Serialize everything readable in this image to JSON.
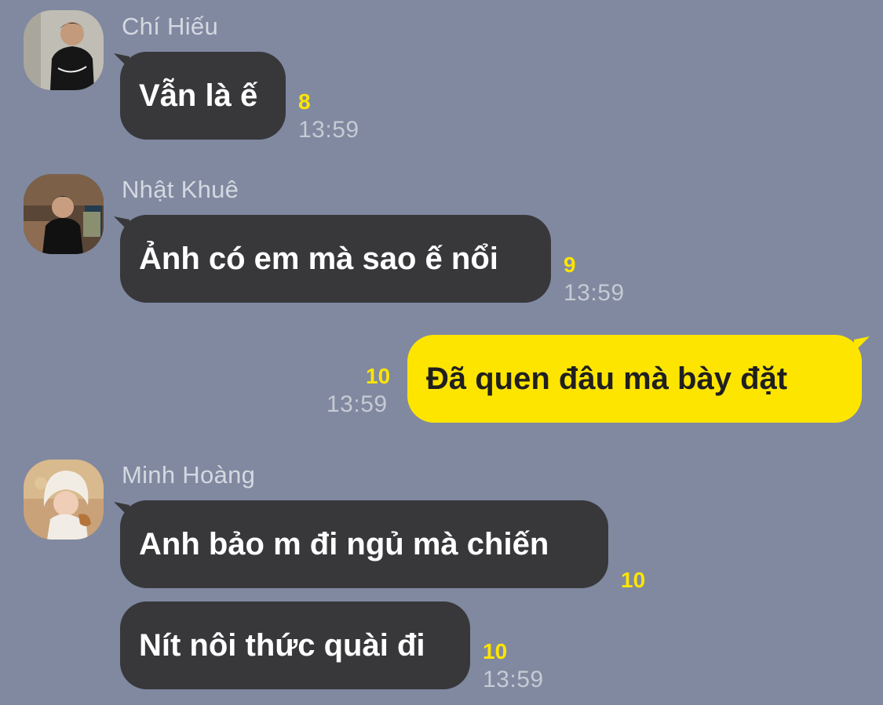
{
  "messages": [
    {
      "sender": "Chí Hiếu",
      "text": "Vẫn là ế",
      "unread": "8",
      "time": "13:59"
    },
    {
      "sender": "Nhật Khuê",
      "text": "Ảnh có em mà sao ế nổi",
      "unread": "9",
      "time": "13:59"
    },
    {
      "text": "Đã quen đâu mà bày đặt",
      "unread": "10",
      "time": "13:59"
    },
    {
      "sender": "Minh Hoàng",
      "text": "Anh bảo m đi ngủ mà chiến",
      "unread": "10"
    },
    {
      "text": "Nít nôi thức quài đi",
      "unread": "10",
      "time": "13:59"
    }
  ],
  "colors": {
    "background": "#8089a0",
    "incoming_bubble": "#38383b",
    "outgoing_bubble": "#fee500",
    "unread_count": "#fee500"
  }
}
